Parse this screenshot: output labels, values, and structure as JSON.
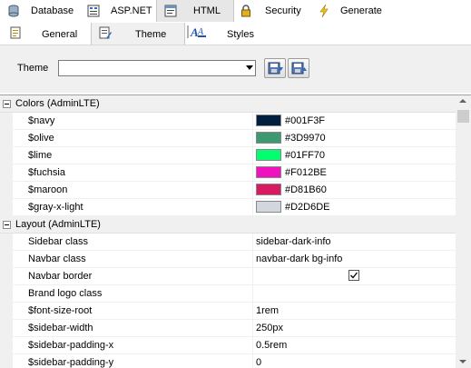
{
  "toolbar_tabs": [
    {
      "label": "Database",
      "icon": "database-icon"
    },
    {
      "label": "ASP.NET",
      "icon": "aspnet-icon"
    },
    {
      "label": "HTML",
      "icon": "html-icon"
    },
    {
      "label": "Security",
      "icon": "lock-icon"
    },
    {
      "label": "Generate",
      "icon": "lightning-icon"
    }
  ],
  "sub_tabs": [
    {
      "label": "General",
      "icon": "document-icon"
    },
    {
      "label": "Theme",
      "icon": "paint-icon"
    },
    {
      "label": "Styles",
      "icon": "styles-icon"
    }
  ],
  "theme": {
    "label": "Theme",
    "value": ""
  },
  "groups": {
    "colors": {
      "title": "Colors (AdminLTE)",
      "rows": [
        {
          "name": "$navy",
          "value": "#001F3F",
          "color": "#001F3F"
        },
        {
          "name": "$olive",
          "value": "#3D9970",
          "color": "#3D9970"
        },
        {
          "name": "$lime",
          "value": "#01FF70",
          "color": "#01FF70"
        },
        {
          "name": "$fuchsia",
          "value": "#F012BE",
          "color": "#F012BE"
        },
        {
          "name": "$maroon",
          "value": "#D81B60",
          "color": "#D81B60"
        },
        {
          "name": "$gray-x-light",
          "value": "#D2D6DE",
          "color": "#D2D6DE"
        }
      ]
    },
    "layout": {
      "title": "Layout (AdminLTE)",
      "rows": [
        {
          "name": "Sidebar class",
          "value": "sidebar-dark-info"
        },
        {
          "name": "Navbar class",
          "value": "navbar-dark bg-info"
        },
        {
          "name": "Navbar border",
          "checked": true
        },
        {
          "name": "Brand logo class",
          "value": ""
        },
        {
          "name": "$font-size-root",
          "value": "1rem"
        },
        {
          "name": "$sidebar-width",
          "value": "250px"
        },
        {
          "name": "$sidebar-padding-x",
          "value": "0.5rem"
        },
        {
          "name": "$sidebar-padding-y",
          "value": "0"
        }
      ]
    }
  }
}
